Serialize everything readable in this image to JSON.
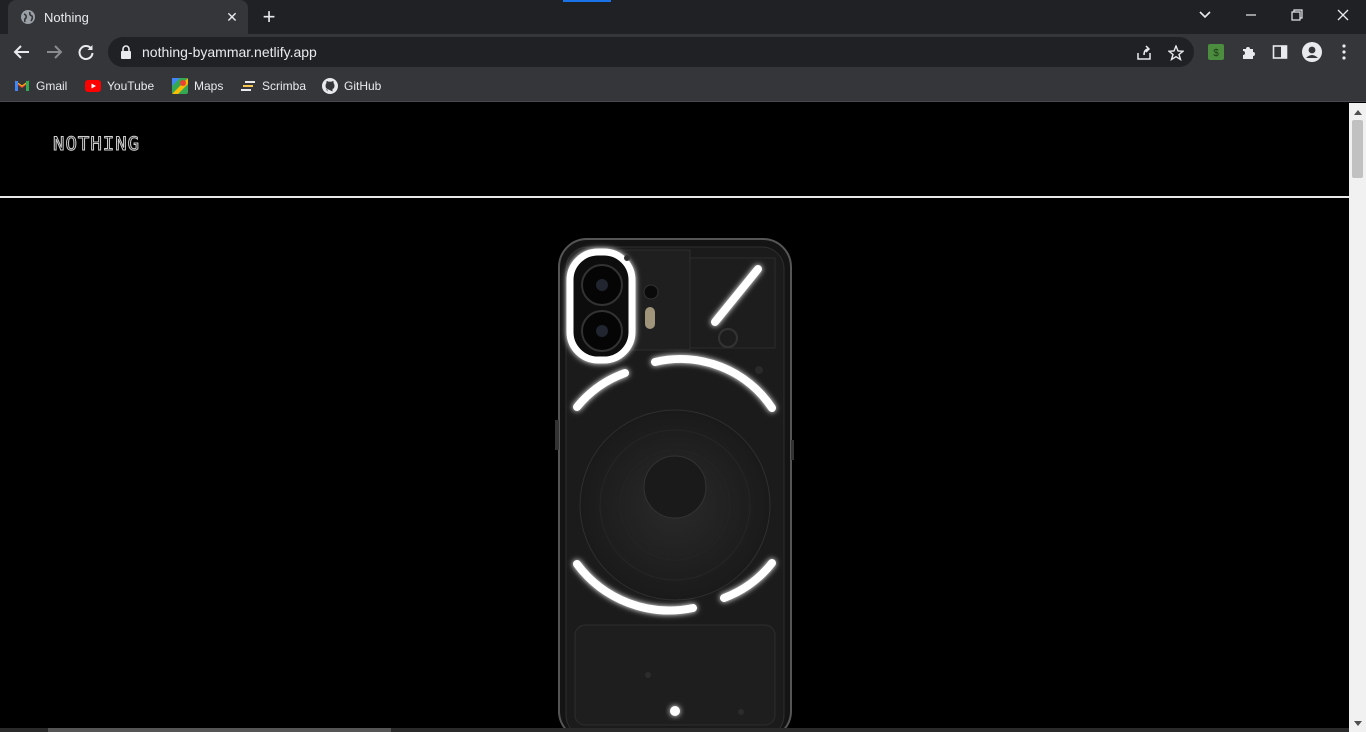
{
  "browser": {
    "tab": {
      "title": "Nothing",
      "close": "✕"
    },
    "new_tab": "+",
    "address_bar": {
      "url": "nothing-byammar.netlify.app"
    },
    "bookmarks": [
      {
        "label": "Gmail",
        "icon": "gmail-icon"
      },
      {
        "label": "YouTube",
        "icon": "youtube-icon"
      },
      {
        "label": "Maps",
        "icon": "maps-icon"
      },
      {
        "label": "Scrimba",
        "icon": "scrimba-icon"
      },
      {
        "label": "GitHub",
        "icon": "github-icon"
      }
    ]
  },
  "site": {
    "logo": "NOTHING"
  },
  "colors": {
    "tabstrip": "#202124",
    "toolbar": "#35363a",
    "page_bg": "#000000",
    "extension_green": "#4c8c3f"
  }
}
